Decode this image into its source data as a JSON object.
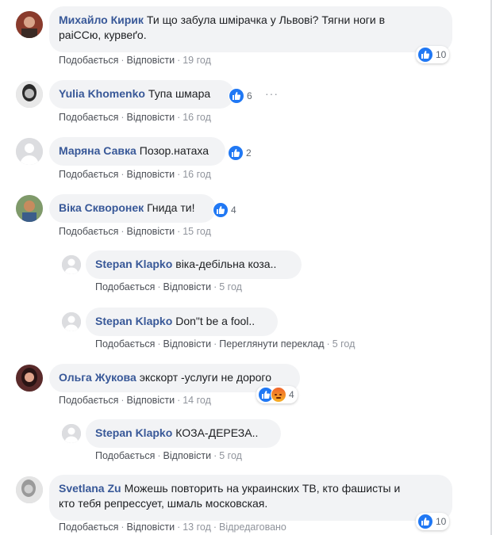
{
  "colors": {
    "author": "#385898",
    "bubble": "#f2f3f5",
    "meta": "#90949c",
    "like": "#2078f4"
  },
  "comments": [
    {
      "author": "Михайло Кирик",
      "text": "Ти що забула шмірачка у Львові? Тягни ноги в",
      "text2": "раіССю, курвеґо.",
      "like": "Подобається",
      "reply": "Відповісти",
      "time": "19 год",
      "reactions": "10"
    },
    {
      "author": "Yulia Khomenko",
      "text": "Тупа шмара",
      "like": "Подобається",
      "reply": "Відповісти",
      "time": "16 год",
      "reactions": "6",
      "more": "···"
    },
    {
      "author": "Маряна Савка",
      "text": "Позор.натаха",
      "like": "Подобається",
      "reply": "Відповісти",
      "time": "16 год",
      "reactions": "2"
    },
    {
      "author": "Віка Скворонек",
      "text": "Гнида ти!",
      "like": "Подобається",
      "reply": "Відповісти",
      "time": "15 год",
      "reactions": "4"
    },
    {
      "author": "Stepan Klapko",
      "text": "віка-дебільна коза..",
      "like": "Подобається",
      "reply": "Відповісти",
      "time": "5 год"
    },
    {
      "author": "Stepan Klapko",
      "text": "Don\"t be a fool..",
      "like": "Подобається",
      "reply": "Відповісти",
      "translate": "Переглянути переклад",
      "time": "5 год"
    },
    {
      "author": "Ольга Жукова",
      "text": "экскорт -услуги не дорого",
      "like": "Подобається",
      "reply": "Відповісти",
      "time": "14 год",
      "reactions": "4"
    },
    {
      "author": "Stepan Klapko",
      "text": "КОЗА-ДЕРЕЗА..",
      "like": "Подобається",
      "reply": "Відповісти",
      "time": "5 год"
    },
    {
      "author": "Svetlana Zu",
      "text": "Можешь повторить на украинских ТВ, кто фашисты и",
      "text2": "кто тебя репрессует, шмаль московская.",
      "like": "Подобається",
      "reply": "Відповісти",
      "time": "13 год",
      "edited": "Відредаговано",
      "reactions": "10"
    }
  ],
  "separator": "·"
}
